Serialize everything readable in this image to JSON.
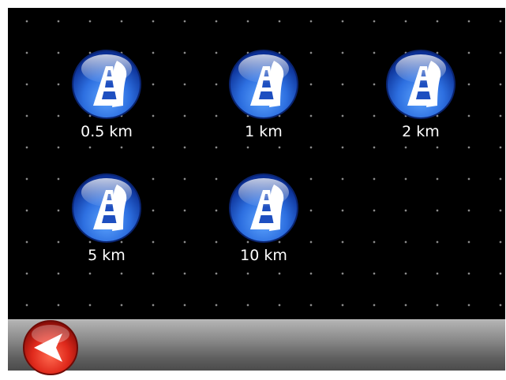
{
  "distance_options": [
    {
      "label": "0.5 km",
      "icon": "road-icon"
    },
    {
      "label": "1 km",
      "icon": "road-icon"
    },
    {
      "label": "2 km",
      "icon": "road-icon"
    },
    {
      "label": "5 km",
      "icon": "road-icon"
    },
    {
      "label": "10 km",
      "icon": "road-icon"
    }
  ],
  "toolbar": {
    "back_icon": "back-arrow-icon"
  },
  "colors": {
    "background": "#000000",
    "dot_grid": "#8a8a8a",
    "icon_blue": "#2a5fd1",
    "back_red": "#d42a20",
    "toolbar_gray": "#8e8e8e",
    "label_text": "#ffffff"
  }
}
